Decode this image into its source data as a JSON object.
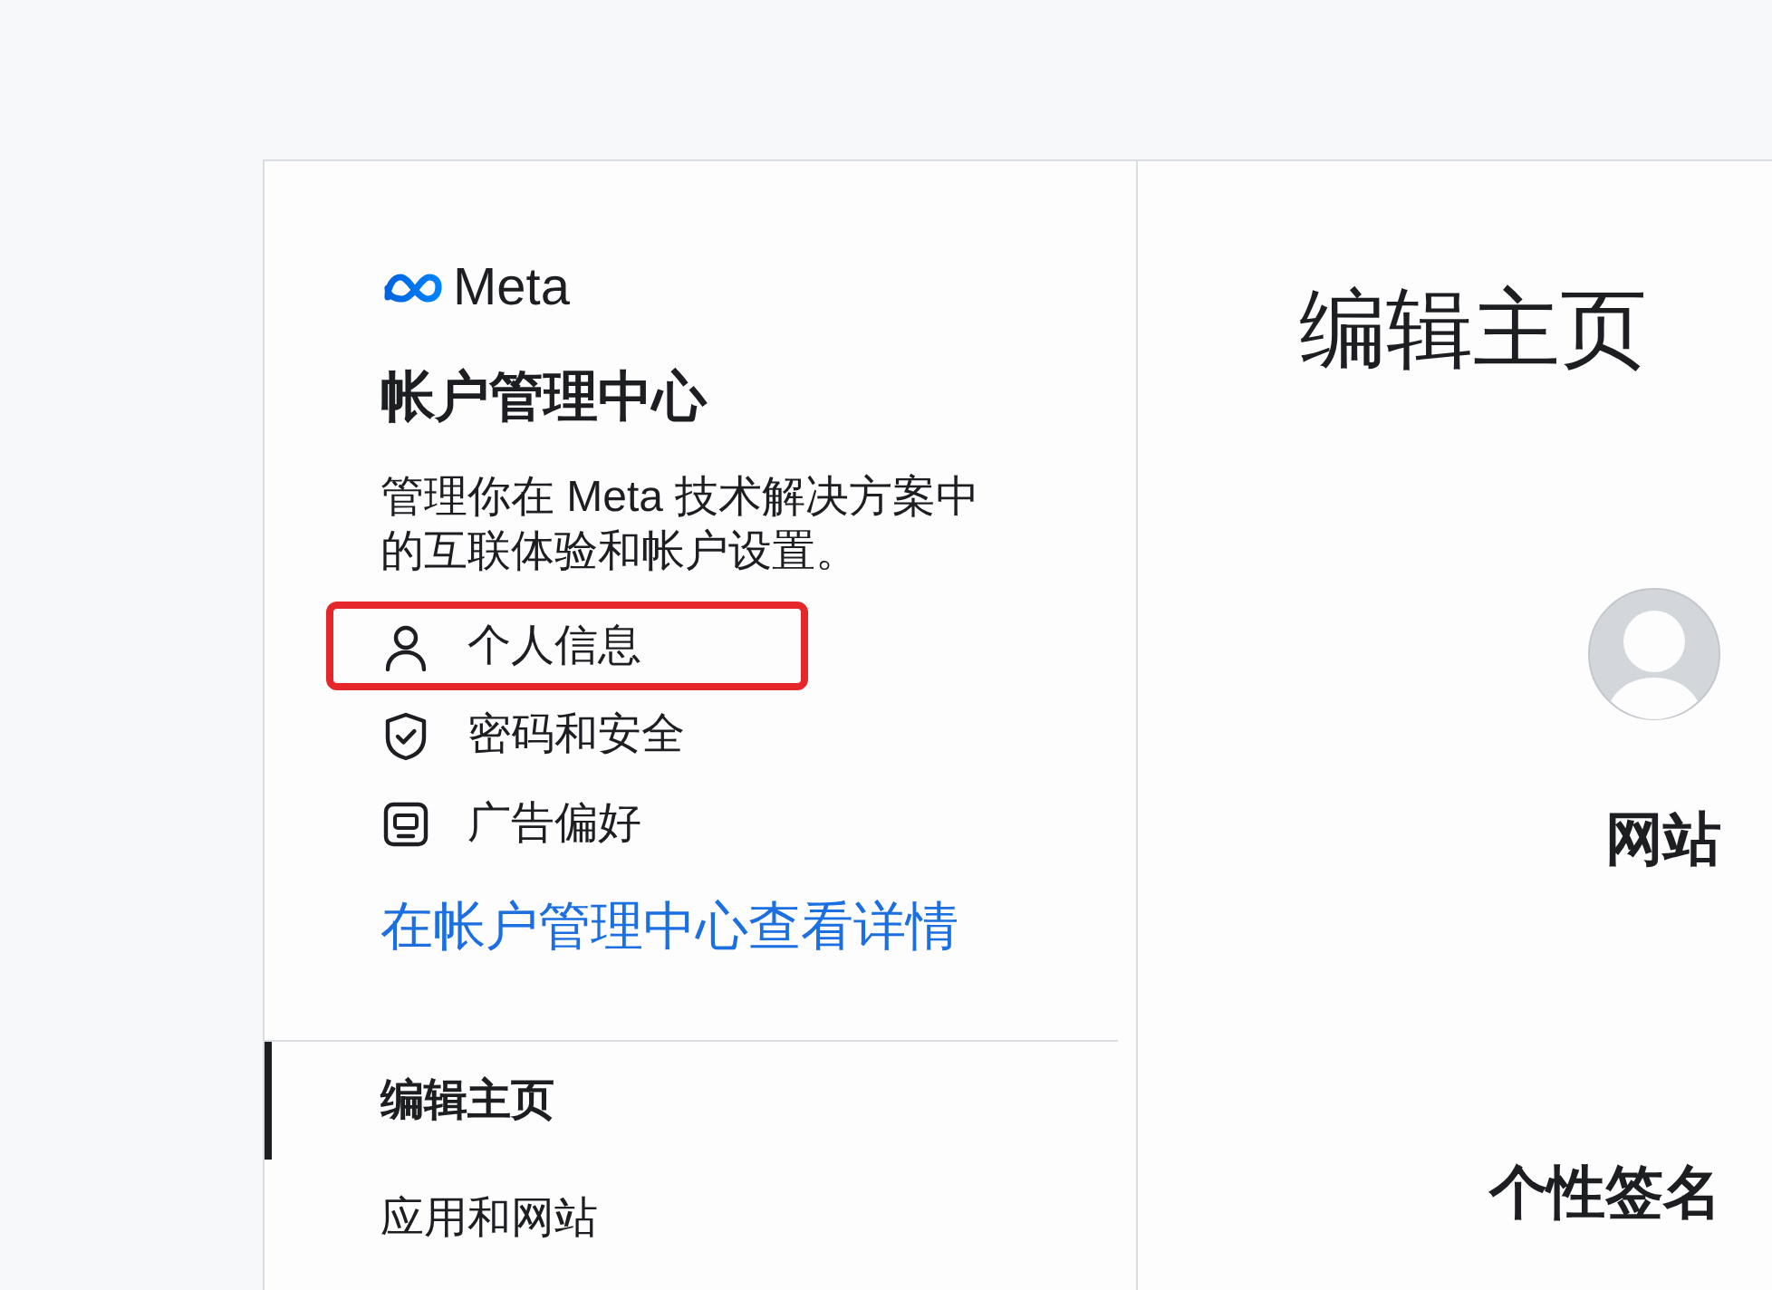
{
  "account_center": {
    "logo_text": "Meta",
    "title": "帐户管理中心",
    "description": "管理你在 Meta 技术解决方案中的互联体验和帐户设置。",
    "menu": [
      {
        "kind": "person",
        "label": "个人信息",
        "highlighted": true
      },
      {
        "kind": "shield",
        "label": "密码和安全",
        "highlighted": false
      },
      {
        "kind": "ad",
        "label": "广告偏好",
        "highlighted": false
      }
    ],
    "link": "在帐户管理中心查看详情"
  },
  "sidebar": {
    "items": [
      {
        "label": "编辑主页",
        "selected": true
      },
      {
        "label": "应用和网站",
        "selected": false
      }
    ]
  },
  "main": {
    "title": "编辑主页",
    "fields": [
      {
        "kind": "avatar"
      },
      {
        "kind": "label",
        "label": "网站"
      },
      {
        "kind": "label",
        "label": "个性签名"
      }
    ]
  }
}
